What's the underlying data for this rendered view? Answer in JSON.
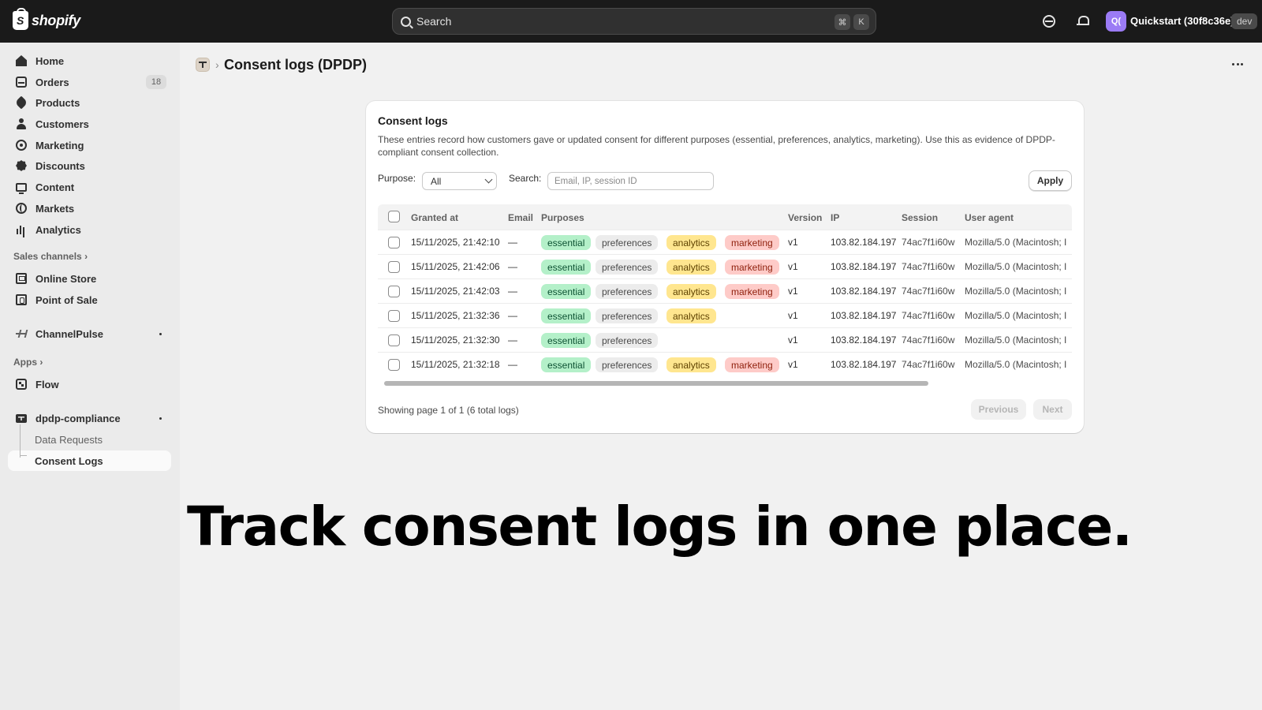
{
  "topbar": {
    "brand": "shopify",
    "search_placeholder": "Search",
    "shortcut_key1": "⌘",
    "shortcut_key2": "K",
    "avatar_initials": "Q(",
    "store_name": "Quickstart (30f8c36e)",
    "badge": "dev"
  },
  "sidebar": {
    "items": [
      {
        "label": "Home",
        "icon": "home-icon"
      },
      {
        "label": "Orders",
        "icon": "orders-icon",
        "count": "18"
      },
      {
        "label": "Products",
        "icon": "tag-icon"
      },
      {
        "label": "Customers",
        "icon": "person-icon"
      },
      {
        "label": "Marketing",
        "icon": "target-icon"
      },
      {
        "label": "Discounts",
        "icon": "discount-icon"
      },
      {
        "label": "Content",
        "icon": "content-icon"
      },
      {
        "label": "Markets",
        "icon": "globe-icon"
      },
      {
        "label": "Analytics",
        "icon": "bar-chart-icon"
      }
    ],
    "sales_channels_label": "Sales channels",
    "sales_channels": [
      {
        "label": "Online Store",
        "icon": "online-store-icon"
      },
      {
        "label": "Point of Sale",
        "icon": "pos-icon"
      }
    ],
    "channelpulse": "ChannelPulse",
    "apps_label": "Apps",
    "flow": "Flow",
    "app_name": "dpdp-compliance",
    "app_subitems": [
      "Data Requests",
      "Consent Logs"
    ]
  },
  "page": {
    "breadcrumb_chevron": "›",
    "title": "Consent logs (DPDP)"
  },
  "card": {
    "title": "Consent logs",
    "description": "These entries record how customers gave or updated consent for different purposes (essential, preferences, analytics, marketing). Use this as evidence of DPDP-compliant consent collection.",
    "purpose_label": "Purpose:",
    "purpose_value": "All",
    "search_label": "Search:",
    "search_placeholder": "Email, IP, session ID",
    "apply_label": "Apply",
    "columns": [
      "Granted at",
      "Email",
      "Purposes",
      "Version",
      "IP",
      "Session",
      "User agent"
    ],
    "rows": [
      {
        "granted_at": "15/11/2025, 21:42:10",
        "email": "—",
        "purposes": [
          "essential",
          "preferences",
          "analytics",
          "marketing"
        ],
        "version": "v1",
        "ip": "103.82.184.197",
        "session": "74ac7f1i60w",
        "user_agent": "Mozilla/5.0 (Macintosh; I"
      },
      {
        "granted_at": "15/11/2025, 21:42:06",
        "email": "—",
        "purposes": [
          "essential",
          "preferences",
          "analytics",
          "marketing"
        ],
        "version": "v1",
        "ip": "103.82.184.197",
        "session": "74ac7f1i60w",
        "user_agent": "Mozilla/5.0 (Macintosh; I"
      },
      {
        "granted_at": "15/11/2025, 21:42:03",
        "email": "—",
        "purposes": [
          "essential",
          "preferences",
          "analytics",
          "marketing"
        ],
        "version": "v1",
        "ip": "103.82.184.197",
        "session": "74ac7f1i60w",
        "user_agent": "Mozilla/5.0 (Macintosh; I"
      },
      {
        "granted_at": "15/11/2025, 21:32:36",
        "email": "—",
        "purposes": [
          "essential",
          "preferences",
          "analytics"
        ],
        "version": "v1",
        "ip": "103.82.184.197",
        "session": "74ac7f1i60w",
        "user_agent": "Mozilla/5.0 (Macintosh; I"
      },
      {
        "granted_at": "15/11/2025, 21:32:30",
        "email": "—",
        "purposes": [
          "essential",
          "preferences"
        ],
        "version": "v1",
        "ip": "103.82.184.197",
        "session": "74ac7f1i60w",
        "user_agent": "Mozilla/5.0 (Macintosh; I"
      },
      {
        "granted_at": "15/11/2025, 21:32:18",
        "email": "—",
        "purposes": [
          "essential",
          "preferences",
          "analytics",
          "marketing"
        ],
        "version": "v1",
        "ip": "103.82.184.197",
        "session": "74ac7f1i60w",
        "user_agent": "Mozilla/5.0 (Macintosh; I"
      }
    ],
    "showing": "Showing page 1 of 1 (6 total logs)",
    "previous_label": "Previous",
    "next_label": "Next"
  },
  "headline": "Track consent logs in one place."
}
